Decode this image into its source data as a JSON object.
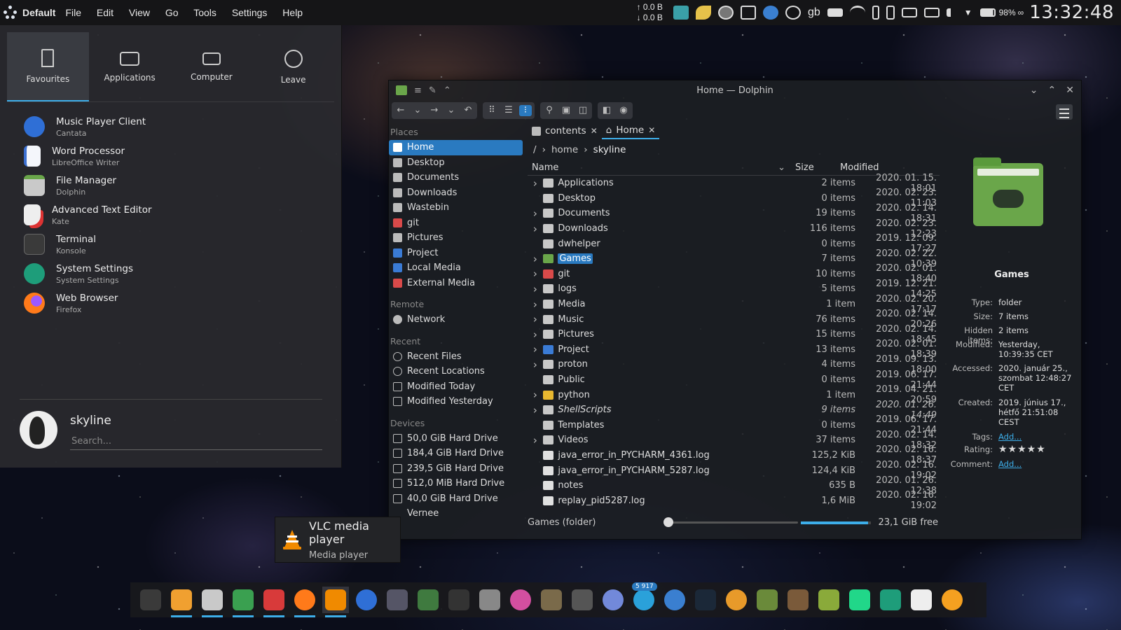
{
  "topbar": {
    "workspace": "Default",
    "menu": [
      "File",
      "Edit",
      "View",
      "Go",
      "Tools",
      "Settings",
      "Help"
    ],
    "net_up": "0.0 B",
    "net_down": "0.0 B",
    "keyboard_layout": "gb",
    "battery": "98%",
    "clock": "13:32:48"
  },
  "launcher": {
    "tabs": [
      {
        "label": "Favourites",
        "icon": "bookmark-icon"
      },
      {
        "label": "Applications",
        "icon": "applications-icon"
      },
      {
        "label": "Computer",
        "icon": "laptop-icon"
      },
      {
        "label": "Leave",
        "icon": "leave-icon"
      }
    ],
    "favourites": [
      {
        "title": "Music Player Client",
        "subtitle": "Cantata",
        "icon": "cantata-icon",
        "color": "#2f6fd6"
      },
      {
        "title": "Word Processor",
        "subtitle": "LibreOffice Writer",
        "icon": "writer-icon",
        "color": "#3b6fd1"
      },
      {
        "title": "File Manager",
        "subtitle": "Dolphin",
        "icon": "dolphin-icon",
        "color": "#c9c9c9"
      },
      {
        "title": "Advanced Text Editor",
        "subtitle": "Kate",
        "icon": "kate-icon",
        "color": "#e9e9e9"
      },
      {
        "title": "Terminal",
        "subtitle": "Konsole",
        "icon": "konsole-icon",
        "color": "#3a3a3a"
      },
      {
        "title": "System Settings",
        "subtitle": "System Settings",
        "icon": "settings-icon",
        "color": "#1e9d7a"
      },
      {
        "title": "Web Browser",
        "subtitle": "Firefox",
        "icon": "firefox-icon",
        "color": "#ff7a1a"
      }
    ],
    "user": "skyline",
    "search_placeholder": "Search..."
  },
  "dolphin": {
    "title": "Home — Dolphin",
    "places": {
      "places_header": "Places",
      "places": [
        "Home",
        "Desktop",
        "Documents",
        "Downloads",
        "Wastebin",
        "git",
        "Pictures",
        "Project",
        "Local Media",
        "External Media"
      ],
      "remote_header": "Remote",
      "remote": [
        "Network"
      ],
      "recent_header": "Recent",
      "recent": [
        "Recent Files",
        "Recent Locations",
        "Modified Today",
        "Modified Yesterday"
      ],
      "devices_header": "Devices",
      "devices": [
        "50,0 GiB Hard Drive",
        "184,4 GiB Hard Drive",
        "239,5 GiB Hard Drive",
        "512,0 MiB Hard Drive",
        "40,0 GiB Hard Drive",
        "Vernee"
      ]
    },
    "tabs": [
      "contents",
      "Home"
    ],
    "breadcrumb": [
      "/",
      "home",
      "skyline"
    ],
    "columns": {
      "name": "Name",
      "size": "Size",
      "modified": "Modified"
    },
    "rows": [
      {
        "name": "Applications",
        "size": "2 items",
        "modified": "2020. 01. 15. 18:01",
        "expand": true,
        "color": "#c8c8c8"
      },
      {
        "name": "Desktop",
        "size": "0 items",
        "modified": "2020. 02. 23. 11:03",
        "expand": false,
        "color": "#c8c8c8"
      },
      {
        "name": "Documents",
        "size": "19 items",
        "modified": "2020. 02. 14. 18:31",
        "expand": true,
        "color": "#c8c8c8"
      },
      {
        "name": "Downloads",
        "size": "116 items",
        "modified": "2020. 02. 23. 12:23",
        "expand": true,
        "color": "#c8c8c8"
      },
      {
        "name": "dwhelper",
        "size": "0 items",
        "modified": "2019. 12. 09. 17:27",
        "expand": false,
        "color": "#c8c8c8"
      },
      {
        "name": "Games",
        "size": "7 items",
        "modified": "2020. 02. 22. 10:39",
        "expand": true,
        "color": "#6aa64a"
      },
      {
        "name": "git",
        "size": "10 items",
        "modified": "2020. 02. 01. 18:40",
        "expand": true,
        "color": "#d94a4a"
      },
      {
        "name": "logs",
        "size": "5 items",
        "modified": "2019. 12. 21. 14:25",
        "expand": true,
        "color": "#c8c8c8"
      },
      {
        "name": "Media",
        "size": "1 item",
        "modified": "2020. 02. 20. 17:17",
        "expand": true,
        "color": "#c8c8c8"
      },
      {
        "name": "Music",
        "size": "76 items",
        "modified": "2020. 02. 14. 20:26",
        "expand": true,
        "color": "#c8c8c8"
      },
      {
        "name": "Pictures",
        "size": "15 items",
        "modified": "2020. 02. 14. 18:45",
        "expand": true,
        "color": "#c8c8c8"
      },
      {
        "name": "Project",
        "size": "13 items",
        "modified": "2020. 02. 01. 18:39",
        "expand": true,
        "color": "#3a7bd5"
      },
      {
        "name": "proton",
        "size": "4 items",
        "modified": "2019. 09. 13. 18:00",
        "expand": true,
        "color": "#c8c8c8"
      },
      {
        "name": "Public",
        "size": "0 items",
        "modified": "2019. 06. 17. 21:44",
        "expand": false,
        "color": "#c8c8c8"
      },
      {
        "name": "python",
        "size": "1 item",
        "modified": "2019. 04. 21. 20:59",
        "expand": true,
        "color": "#e8b830"
      },
      {
        "name": "ShellScripts",
        "size": "9 items",
        "modified": "2020. 01. 26. 14:49",
        "expand": true,
        "color": "#c8c8c8",
        "italic": true
      },
      {
        "name": "Templates",
        "size": "0 items",
        "modified": "2019. 06. 17. 21:44",
        "expand": false,
        "color": "#c8c8c8"
      },
      {
        "name": "Videos",
        "size": "37 items",
        "modified": "2020. 02. 14. 18:32",
        "expand": true,
        "color": "#c8c8c8"
      },
      {
        "name": "java_error_in_PYCHARM_4361.log",
        "size": "125,2 KiB",
        "modified": "2020. 02. 16. 18:37",
        "expand": false,
        "color": "#e0e0e0"
      },
      {
        "name": "java_error_in_PYCHARM_5287.log",
        "size": "124,4 KiB",
        "modified": "2020. 02. 16. 19:02",
        "expand": false,
        "color": "#e0e0e0"
      },
      {
        "name": "notes",
        "size": "635 B",
        "modified": "2020. 01. 26. 12:38",
        "expand": false,
        "color": "#e0e0e0"
      },
      {
        "name": "replay_pid5287.log",
        "size": "1,6 MiB",
        "modified": "2020. 02. 16. 19:02",
        "expand": false,
        "color": "#e0e0e0"
      }
    ],
    "status": {
      "selection": "Games (folder)",
      "free": "23,1 GiB free",
      "free_fraction": 0.96
    },
    "info": {
      "name": "Games",
      "type_k": "Type:",
      "type_v": "folder",
      "size_k": "Size:",
      "size_v": "7 items",
      "hidden_k": "Hidden items:",
      "hidden_v": "2 items",
      "modified_k": "Modified:",
      "modified_v1": "Yesterday,",
      "modified_v2": "10:39:35 CET",
      "accessed_k": "Accessed:",
      "accessed_v1": "2020. január 25.,",
      "accessed_v2": "szombat 12:48:27",
      "accessed_v3": "CET",
      "created_k": "Created:",
      "created_v1": "2019. június 17.,",
      "created_v2": "hétfő 21:51:08",
      "created_v3": "CEST",
      "tags_k": "Tags:",
      "tags_v": "Add...",
      "rating_k": "Rating:",
      "rating_v": "★★★★★",
      "comment_k": "Comment:",
      "comment_v": "Add..."
    }
  },
  "tooltip": {
    "title": "VLC media player",
    "subtitle": "Media player"
  },
  "taskbar": {
    "apps": [
      {
        "name": "konsole",
        "color": "#3a3a3a"
      },
      {
        "name": "atom",
        "color": "#f0a030"
      },
      {
        "name": "dolphin",
        "color": "#c9c9c9"
      },
      {
        "name": "gwenview",
        "color": "#3aa050"
      },
      {
        "name": "kdenlive",
        "color": "#d83a3a"
      },
      {
        "name": "firefox",
        "color": "#ff7a1a"
      },
      {
        "name": "vlc",
        "color": "#f08a00"
      },
      {
        "name": "cantata",
        "color": "#2f6fd6"
      },
      {
        "name": "ksysguard",
        "color": "#556"
      },
      {
        "name": "ktorrent",
        "color": "#3f7a3f"
      },
      {
        "name": "kget",
        "color": "#333"
      },
      {
        "name": "ark",
        "color": "#888"
      },
      {
        "name": "krita",
        "color": "#d34fa0"
      },
      {
        "name": "gimp",
        "color": "#7a6a4a"
      },
      {
        "name": "inkscape",
        "color": "#555"
      },
      {
        "name": "discord",
        "color": "#7289da"
      },
      {
        "name": "telegram",
        "color": "#2aa1da",
        "badge": "5 917"
      },
      {
        "name": "thunderbird",
        "color": "#3a7fd0"
      },
      {
        "name": "steam",
        "color": "#1b2838"
      },
      {
        "name": "settings-gear",
        "color": "#e89a2a"
      },
      {
        "name": "minecraft",
        "color": "#6a8a3a"
      },
      {
        "name": "minecraft2",
        "color": "#7a5a3a"
      },
      {
        "name": "android",
        "color": "#8aaa3a"
      },
      {
        "name": "pycharm",
        "color": "#21d789"
      },
      {
        "name": "system-settings",
        "color": "#1e9d7a"
      },
      {
        "name": "kate",
        "color": "#eee"
      },
      {
        "name": "blender",
        "color": "#f5a020"
      }
    ]
  }
}
